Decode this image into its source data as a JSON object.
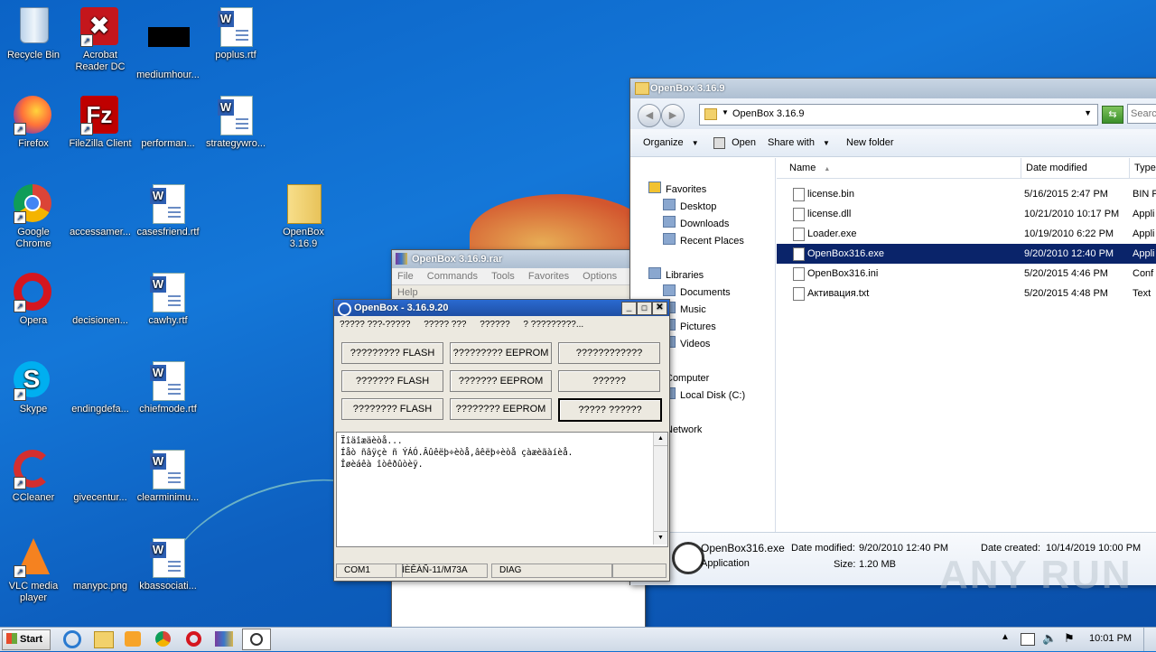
{
  "desktop": {
    "icons": [
      {
        "label": "Recycle Bin"
      },
      {
        "label": "Acrobat Reader DC"
      },
      {
        "label": "mediumhour..."
      },
      {
        "label": "poplus.rtf"
      },
      {
        "label": "Firefox"
      },
      {
        "label": "FileZilla Client"
      },
      {
        "label": "performan..."
      },
      {
        "label": "strategywro..."
      },
      {
        "label": "Google Chrome"
      },
      {
        "label": "accessamer..."
      },
      {
        "label": "casesfriend.rtf"
      },
      {
        "label": "OpenBox 3.16.9"
      },
      {
        "label": "Opera"
      },
      {
        "label": "decisionen..."
      },
      {
        "label": "cawhy.rtf"
      },
      {
        "label": "Skype"
      },
      {
        "label": "endingdefa..."
      },
      {
        "label": "chiefmode.rtf"
      },
      {
        "label": "CCleaner"
      },
      {
        "label": "givecentur..."
      },
      {
        "label": "clearminimu..."
      },
      {
        "label": "VLC media player"
      },
      {
        "label": "manypc.png"
      },
      {
        "label": "kbassociati..."
      }
    ]
  },
  "explorer": {
    "title": "OpenBox 3.16.9",
    "address": "OpenBox 3.16.9",
    "search_placeholder": "Searc",
    "toolbar": {
      "organize": "Organize",
      "open": "Open",
      "share": "Share with",
      "new_folder": "New folder"
    },
    "nav": {
      "favorites": "Favorites",
      "desktop": "Desktop",
      "downloads": "Downloads",
      "recent": "Recent Places",
      "libraries": "Libraries",
      "documents": "Documents",
      "music": "Music",
      "pictures": "Pictures",
      "videos": "Videos",
      "computer": "Computer",
      "local_disk": "Local Disk (C:)",
      "network": "Network"
    },
    "columns": {
      "name": "Name",
      "date": "Date modified",
      "type": "Type"
    },
    "files": [
      {
        "name": "license.bin",
        "date": "5/16/2015 2:47 PM",
        "type": "BIN F"
      },
      {
        "name": "license.dll",
        "date": "10/21/2010 10:17 PM",
        "type": "Appli"
      },
      {
        "name": "Loader.exe",
        "date": "10/19/2010 6:22 PM",
        "type": "Appli"
      },
      {
        "name": "OpenBox316.exe",
        "date": "9/20/2010 12:40 PM",
        "type": "Appli"
      },
      {
        "name": "OpenBox316.ini",
        "date": "5/20/2015 4:46 PM",
        "type": "Conf"
      },
      {
        "name": "Активация.txt",
        "date": "5/20/2015 4:48 PM",
        "type": "Text"
      }
    ],
    "details": {
      "name": "OpenBox316.exe",
      "kind": "Application",
      "modified_label": "Date modified:",
      "modified": "9/20/2010 12:40 PM",
      "size_label": "Size:",
      "size": "1.20 MB",
      "created_label": "Date created:",
      "created": "10/14/2019 10:00 PM"
    }
  },
  "winrar": {
    "title": "OpenBox 3.16.9.rar",
    "menu": [
      "File",
      "Commands",
      "Tools",
      "Favorites",
      "Options",
      "Help"
    ]
  },
  "openbox": {
    "title": "OpenBox - 3.16.9.20",
    "menu": [
      "????? ???-?????",
      "????? ???",
      "??????",
      "? ?????????..."
    ],
    "buttons": [
      "????????? FLASH",
      "????????? EEPROM",
      "????????????",
      "??????? FLASH",
      "??????? EEPROM",
      "??????",
      "???????? FLASH",
      "???????? EEPROM",
      "????? ??????"
    ],
    "log": [
      "Ïîäîæäèòå...",
      "Íåò ñâÿçè ñ ÝÁÓ.Âûêëþ÷èòå,âêëþ÷èòå çàæèãàíèå.",
      "Îøèáêà îòêðûòèÿ."
    ],
    "status": [
      "COM1",
      "ÌÈÊÀÑ-11/M73A",
      "DIAG",
      ""
    ]
  },
  "taskbar": {
    "start": "Start",
    "clock": "10:01 PM"
  },
  "watermark": "ANY RUN"
}
